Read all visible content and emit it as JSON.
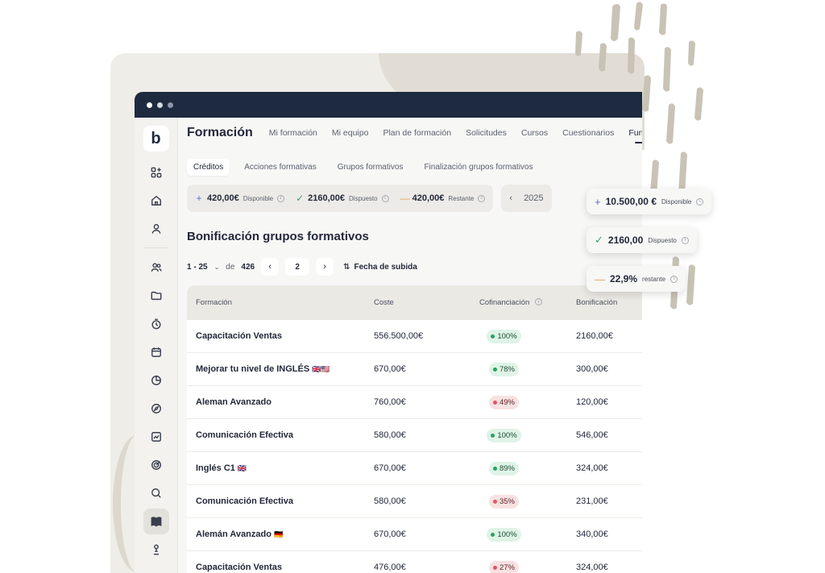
{
  "app": {
    "logo": "b",
    "title": "Formación",
    "nav": [
      "Mi formación",
      "Mi equipo",
      "Plan de formación",
      "Solicitudes",
      "Cursos",
      "Cuestionarios",
      "Fundae"
    ],
    "active_nav": "Fundae"
  },
  "sidebar": {
    "icons": [
      "apps-icon",
      "home-icon",
      "user-icon",
      "users-icon",
      "folder-icon",
      "timer-icon",
      "calendar-icon",
      "pie-chart-icon",
      "compass-icon",
      "analytics-icon",
      "target-icon",
      "search-chart-icon",
      "book-icon",
      "settings-person-icon"
    ],
    "active": "book-icon"
  },
  "subtabs": {
    "items": [
      "Créditos",
      "Acciones formativas",
      "Grupos formativos",
      "Finalización grupos formativos"
    ],
    "active": "Créditos"
  },
  "credits": {
    "available": {
      "symbol": "+",
      "amount": "420,00€",
      "label": "Disponible"
    },
    "used": {
      "symbol": "✓",
      "amount": "2160,00€",
      "label": "Dispuesto"
    },
    "remaining": {
      "symbol": "—",
      "amount": "420,00€",
      "label": "Restante"
    },
    "year": "2025"
  },
  "floating": {
    "available": {
      "symbol": "+",
      "amount": "10.500,00 €",
      "label": "Disponible"
    },
    "used": {
      "symbol": "✓",
      "amount": "2160,00",
      "label": "Dispuesto"
    },
    "remaining": {
      "symbol": "—",
      "amount": "22,9%",
      "label": "restante"
    }
  },
  "section": {
    "title": "Bonificación grupos formativos"
  },
  "pager": {
    "range": "1 - 25",
    "of": "de",
    "total": "426",
    "page": "2",
    "prev": "‹",
    "next": "›",
    "sort_label": "Fecha de subida"
  },
  "table": {
    "headers": [
      "Formación",
      "Coste",
      "Cofinanciación",
      "Bonificación"
    ],
    "rows": [
      {
        "name": "Capacitación Ventas",
        "flag": "",
        "cost": "556.500,00€",
        "cofin": "100%",
        "status": "good",
        "bonus": "2160,00€"
      },
      {
        "name": "Mejorar tu nivel de INGLÉS",
        "flag": "🇬🇧🇺🇸",
        "cost": "670,00€",
        "cofin": "78%",
        "status": "good",
        "bonus": "300,00€"
      },
      {
        "name": "Aleman Avanzado",
        "flag": "",
        "cost": "760,00€",
        "cofin": "49%",
        "status": "bad",
        "bonus": "120,00€"
      },
      {
        "name": "Comunicación Efectiva",
        "flag": "",
        "cost": "580,00€",
        "cofin": "100%",
        "status": "good",
        "bonus": "546,00€"
      },
      {
        "name": "Inglés C1",
        "flag": "🇬🇧",
        "cost": "670,00€",
        "cofin": "89%",
        "status": "good",
        "bonus": "324,00€"
      },
      {
        "name": "Comunicación Efectiva",
        "flag": "",
        "cost": "580,00€",
        "cofin": "35%",
        "status": "bad",
        "bonus": "231,00€"
      },
      {
        "name": "Alemán Avanzado",
        "flag": "🇩🇪",
        "cost": "670,00€",
        "cofin": "100%",
        "status": "good",
        "bonus": "340,00€"
      },
      {
        "name": "Capacitación Ventas",
        "flag": "",
        "cost": "476,00€",
        "cofin": "27%",
        "status": "bad",
        "bonus": "324,00€"
      }
    ]
  },
  "colors": {
    "titlebar": "#1e2a3f",
    "good": "#27a35d",
    "bad": "#e05561",
    "accent": "#5b6bd6"
  }
}
